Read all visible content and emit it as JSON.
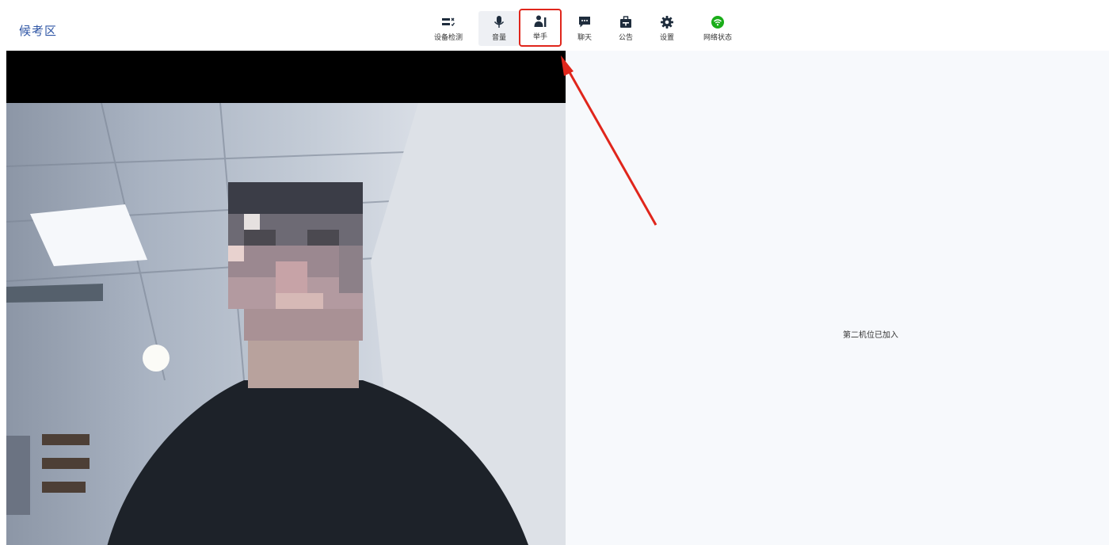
{
  "header": {
    "title": "候考区"
  },
  "toolbar": {
    "items": [
      {
        "label": "设备检测",
        "icon": "device-check-icon"
      },
      {
        "label": "音量",
        "icon": "microphone-icon",
        "active": true
      },
      {
        "label": "举手",
        "icon": "raise-hand-icon",
        "highlighted": true
      },
      {
        "label": "聊天",
        "icon": "chat-icon"
      },
      {
        "label": "公告",
        "icon": "announcement-icon"
      },
      {
        "label": "设置",
        "icon": "gear-icon"
      },
      {
        "label": "网络状态",
        "icon": "wifi-icon"
      }
    ]
  },
  "side_panel": {
    "status": "第二机位已加入"
  },
  "colors": {
    "title": "#2f56a5",
    "highlight": "#e0261c",
    "network_ok": "#1aad19",
    "side_bg": "#f7f9fc"
  }
}
